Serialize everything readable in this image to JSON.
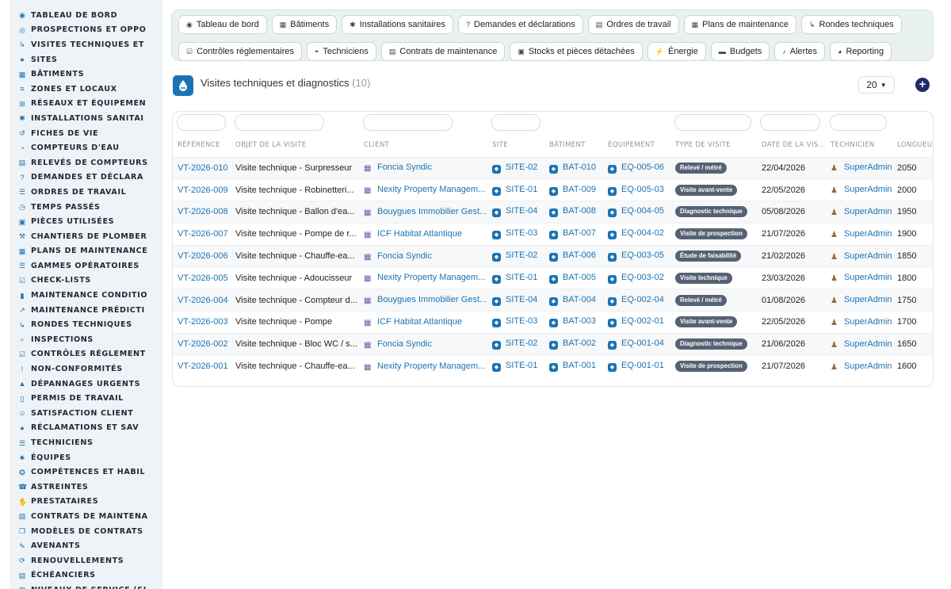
{
  "sidebar": {
    "items": [
      {
        "label": "TABLEAU DE BORD",
        "icon": "dashboard-icon"
      },
      {
        "label": "PROSPECTIONS ET OPPO",
        "icon": "target-icon"
      },
      {
        "label": "VISITES TECHNIQUES ET",
        "icon": "route-icon"
      },
      {
        "label": "SITES",
        "icon": "map-pin-icon"
      },
      {
        "label": "BÂTIMENTS",
        "icon": "building-icon"
      },
      {
        "label": "ZONES ET LOCAUX",
        "icon": "layers-icon"
      },
      {
        "label": "RÉSEAUX ET ÉQUIPEMEN",
        "icon": "sitemap-icon"
      },
      {
        "label": "INSTALLATIONS SANITAI",
        "icon": "cogs-icon"
      },
      {
        "label": "FICHES DE VIE",
        "icon": "history-icon"
      },
      {
        "label": "COMPTEURS D'EAU",
        "icon": "gauge-icon"
      },
      {
        "label": "RELEVÉS DE COMPTEURS",
        "icon": "clipboard-icon"
      },
      {
        "label": "DEMANDES ET DÉCLARA",
        "icon": "question-icon"
      },
      {
        "label": "ORDRES DE TRAVAIL",
        "icon": "list-icon"
      },
      {
        "label": "TEMPS PASSÉS",
        "icon": "clock-icon"
      },
      {
        "label": "PIÈCES UTILISÉES",
        "icon": "boxes-icon"
      },
      {
        "label": "CHANTIERS DE PLOMBER",
        "icon": "hammer-icon"
      },
      {
        "label": "PLANS DE MAINTENANCE",
        "icon": "calendar-icon"
      },
      {
        "label": "GAMMES OPÉRATOIRES",
        "icon": "list-ol-icon"
      },
      {
        "label": "CHECK-LISTS",
        "icon": "checklist-icon"
      },
      {
        "label": "MAINTENANCE CONDITIO",
        "icon": "thermometer-icon"
      },
      {
        "label": "MAINTENANCE PRÉDICTI",
        "icon": "chart-line-icon"
      },
      {
        "label": "RONDES TECHNIQUES",
        "icon": "route-icon"
      },
      {
        "label": "INSPECTIONS",
        "icon": "search-icon"
      },
      {
        "label": "CONTRÔLES RÉGLEMENT",
        "icon": "clipboard-check-icon"
      },
      {
        "label": "NON-CONFORMITÉS",
        "icon": "exclamation-icon"
      },
      {
        "label": "DÉPANNAGES URGENTS",
        "icon": "warning-icon"
      },
      {
        "label": "PERMIS DE TRAVAIL",
        "icon": "file-icon"
      },
      {
        "label": "SATISFACTION CLIENT",
        "icon": "smile-icon"
      },
      {
        "label": "RÉCLAMATIONS ET SAV",
        "icon": "comment-icon"
      },
      {
        "label": "TECHNICIENS",
        "icon": "list-icon"
      },
      {
        "label": "ÉQUIPES",
        "icon": "users-icon"
      },
      {
        "label": "COMPÉTENCES ET HABIL",
        "icon": "certificate-icon"
      },
      {
        "label": "ASTREINTES",
        "icon": "phone-icon"
      },
      {
        "label": "PRESTATAIRES",
        "icon": "handshake-icon"
      },
      {
        "label": "CONTRATS DE MAINTENA",
        "icon": "file-contract-icon"
      },
      {
        "label": "MODÈLES DE CONTRATS",
        "icon": "copy-icon"
      },
      {
        "label": "AVENANTS",
        "icon": "edit-icon"
      },
      {
        "label": "RENOUVELLEMENTS",
        "icon": "refresh-icon"
      },
      {
        "label": "ÉCHÉANCIERS",
        "icon": "file-invoice-icon"
      },
      {
        "label": "NIVEAUX DE SERVICE (SL",
        "icon": "chart-bar-icon"
      }
    ]
  },
  "nav": {
    "row1": [
      {
        "label": "Tableau de bord",
        "icon": "dashboard-icon"
      },
      {
        "label": "Bâtiments",
        "icon": "building-icon"
      },
      {
        "label": "Installations sanitaires",
        "icon": "cogs-icon"
      },
      {
        "label": "Demandes et déclarations",
        "icon": "question-icon"
      },
      {
        "label": "Ordres de travail",
        "icon": "clipboard-icon"
      },
      {
        "label": "Plans de maintenance",
        "icon": "calendar-icon"
      },
      {
        "label": "Rondes techniques",
        "icon": "route-icon"
      }
    ],
    "row2": [
      {
        "label": "Contrôles réglementaires",
        "icon": "clipboard-check-icon"
      },
      {
        "label": "Techniciens",
        "icon": "hard-hat-icon"
      },
      {
        "label": "Contrats de maintenance",
        "icon": "file-contract-icon"
      },
      {
        "label": "Stocks et pièces détachées",
        "icon": "boxes-icon"
      },
      {
        "label": "Énergie",
        "icon": "bolt-icon"
      },
      {
        "label": "Budgets",
        "icon": "money-icon"
      },
      {
        "label": "Alertes",
        "icon": "bell-icon"
      },
      {
        "label": "Reporting",
        "icon": "pie-chart-icon"
      }
    ]
  },
  "header": {
    "title": "Visites techniques et diagnostics",
    "count": "(10)",
    "per_page": "20",
    "add_label": "+"
  },
  "table": {
    "columns": [
      "RÉFÉRENCE",
      "OBJET DE LA VISITE",
      "CLIENT",
      "SITE",
      "BÂTIMENT",
      "ÉQUIPEMENT",
      "TYPE DE VISITE",
      "DATE DE LA VIS...",
      "TECHNICIEN",
      "LONGUEUR"
    ],
    "rows": [
      {
        "ref": "VT-2026-010",
        "objet": "Visite technique - Surpresseur",
        "client": "Foncia Syndic",
        "site": "SITE-02",
        "batiment": "BAT-010",
        "equipement": "EQ-005-06",
        "type": "Relevé / métré",
        "date": "22/04/2026",
        "technicien": "SuperAdmin",
        "longueur": "2050"
      },
      {
        "ref": "VT-2026-009",
        "objet": "Visite technique - Robinetteri...",
        "client": "Nexity Property Managem...",
        "site": "SITE-01",
        "batiment": "BAT-009",
        "equipement": "EQ-005-03",
        "type": "Visite avant-vente",
        "date": "22/05/2026",
        "technicien": "SuperAdmin",
        "longueur": "2000"
      },
      {
        "ref": "VT-2026-008",
        "objet": "Visite technique - Ballon d'ea...",
        "client": "Bouygues Immobilier Gest...",
        "site": "SITE-04",
        "batiment": "BAT-008",
        "equipement": "EQ-004-05",
        "type": "Diagnostic technique",
        "date": "05/08/2026",
        "technicien": "SuperAdmin",
        "longueur": "1950"
      },
      {
        "ref": "VT-2026-007",
        "objet": "Visite technique - Pompe de r...",
        "client": "ICF Habitat Atlantique",
        "site": "SITE-03",
        "batiment": "BAT-007",
        "equipement": "EQ-004-02",
        "type": "Visite de prospection",
        "date": "21/07/2026",
        "technicien": "SuperAdmin",
        "longueur": "1900"
      },
      {
        "ref": "VT-2026-006",
        "objet": "Visite technique - Chauffe-ea...",
        "client": "Foncia Syndic",
        "site": "SITE-02",
        "batiment": "BAT-006",
        "equipement": "EQ-003-05",
        "type": "Étude de faisabilité",
        "date": "21/02/2026",
        "technicien": "SuperAdmin",
        "longueur": "1850"
      },
      {
        "ref": "VT-2026-005",
        "objet": "Visite technique - Adoucisseur",
        "client": "Nexity Property Managem...",
        "site": "SITE-01",
        "batiment": "BAT-005",
        "equipement": "EQ-003-02",
        "type": "Visite technique",
        "date": "23/03/2026",
        "technicien": "SuperAdmin",
        "longueur": "1800"
      },
      {
        "ref": "VT-2026-004",
        "objet": "Visite technique - Compteur d...",
        "client": "Bouygues Immobilier Gest...",
        "site": "SITE-04",
        "batiment": "BAT-004",
        "equipement": "EQ-002-04",
        "type": "Relevé / métré",
        "date": "01/08/2026",
        "technicien": "SuperAdmin",
        "longueur": "1750"
      },
      {
        "ref": "VT-2026-003",
        "objet": "Visite technique - Pompe",
        "client": "ICF Habitat Atlantique",
        "site": "SITE-03",
        "batiment": "BAT-003",
        "equipement": "EQ-002-01",
        "type": "Visite avant-vente",
        "date": "22/05/2026",
        "technicien": "SuperAdmin",
        "longueur": "1700"
      },
      {
        "ref": "VT-2026-002",
        "objet": "Visite technique - Bloc WC / s...",
        "client": "Foncia Syndic",
        "site": "SITE-02",
        "batiment": "BAT-002",
        "equipement": "EQ-001-04",
        "type": "Diagnostic technique",
        "date": "21/06/2026",
        "technicien": "SuperAdmin",
        "longueur": "1650"
      },
      {
        "ref": "VT-2026-001",
        "objet": "Visite technique - Chauffe-ea...",
        "client": "Nexity Property Managem...",
        "site": "SITE-01",
        "batiment": "BAT-001",
        "equipement": "EQ-001-01",
        "type": "Visite de prospection",
        "date": "21/07/2026",
        "technicien": "SuperAdmin",
        "longueur": "1600"
      }
    ]
  },
  "colors": {
    "accent": "#1b73b4",
    "badge": "#566273",
    "nav_bg": "#eaf2ee",
    "sidebar_bg": "#eef3f7",
    "add_button": "#1f2a6b"
  }
}
